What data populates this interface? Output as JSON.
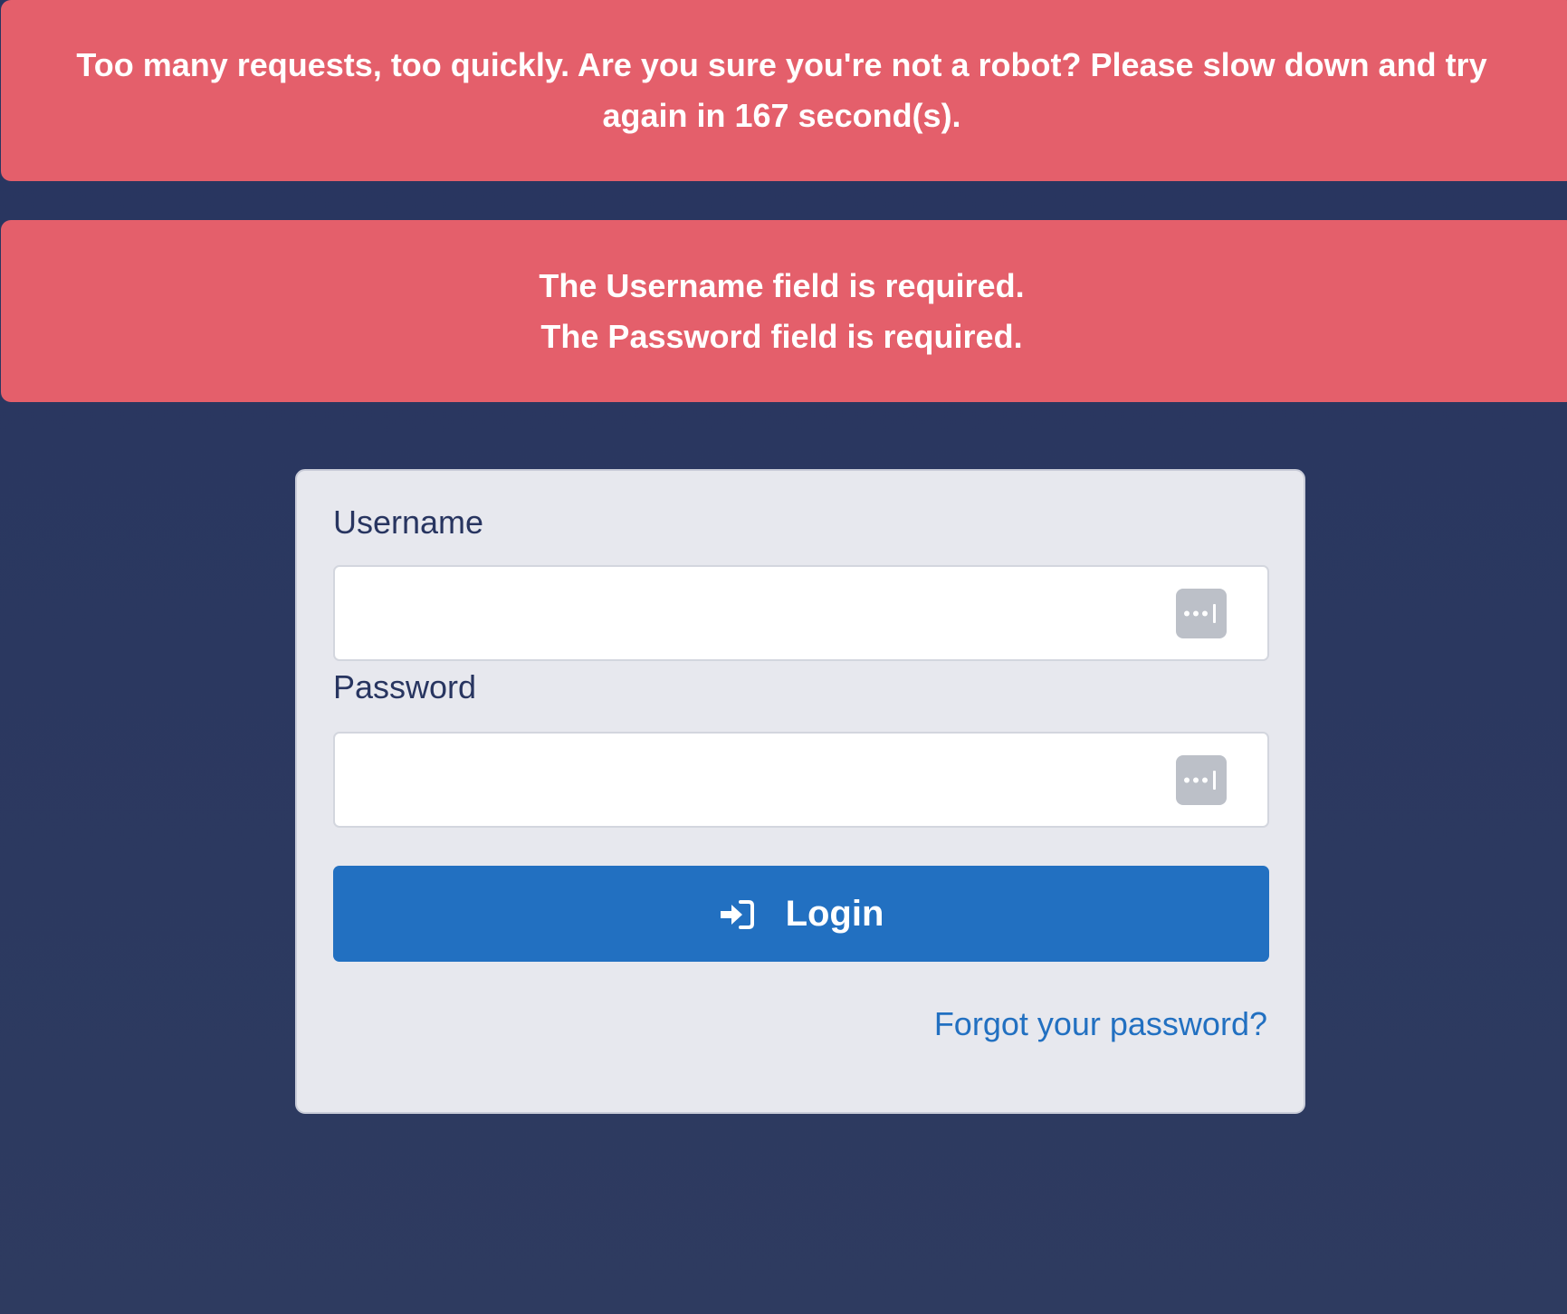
{
  "alerts": {
    "rate_limit": {
      "line1": "Too many requests, too quickly. Are you sure you're not a robot? Please slow down and try",
      "line2": "again in 167 second(s)."
    },
    "validation": {
      "line1": "The Username field is required.",
      "line2": "The Password field is required."
    }
  },
  "form": {
    "username_label": "Username",
    "username_value": "",
    "password_label": "Password",
    "password_value": "",
    "login_label": "Login",
    "forgot_link": "Forgot your password?"
  },
  "icons": {
    "field_icon": "password-manager-icon",
    "login_icon": "sign-in-icon"
  },
  "colors": {
    "background": "#2e3b60",
    "alert": "#e45f6b",
    "card": "#e7e8ee",
    "primary": "#2270c1",
    "label_text": "#283560"
  }
}
